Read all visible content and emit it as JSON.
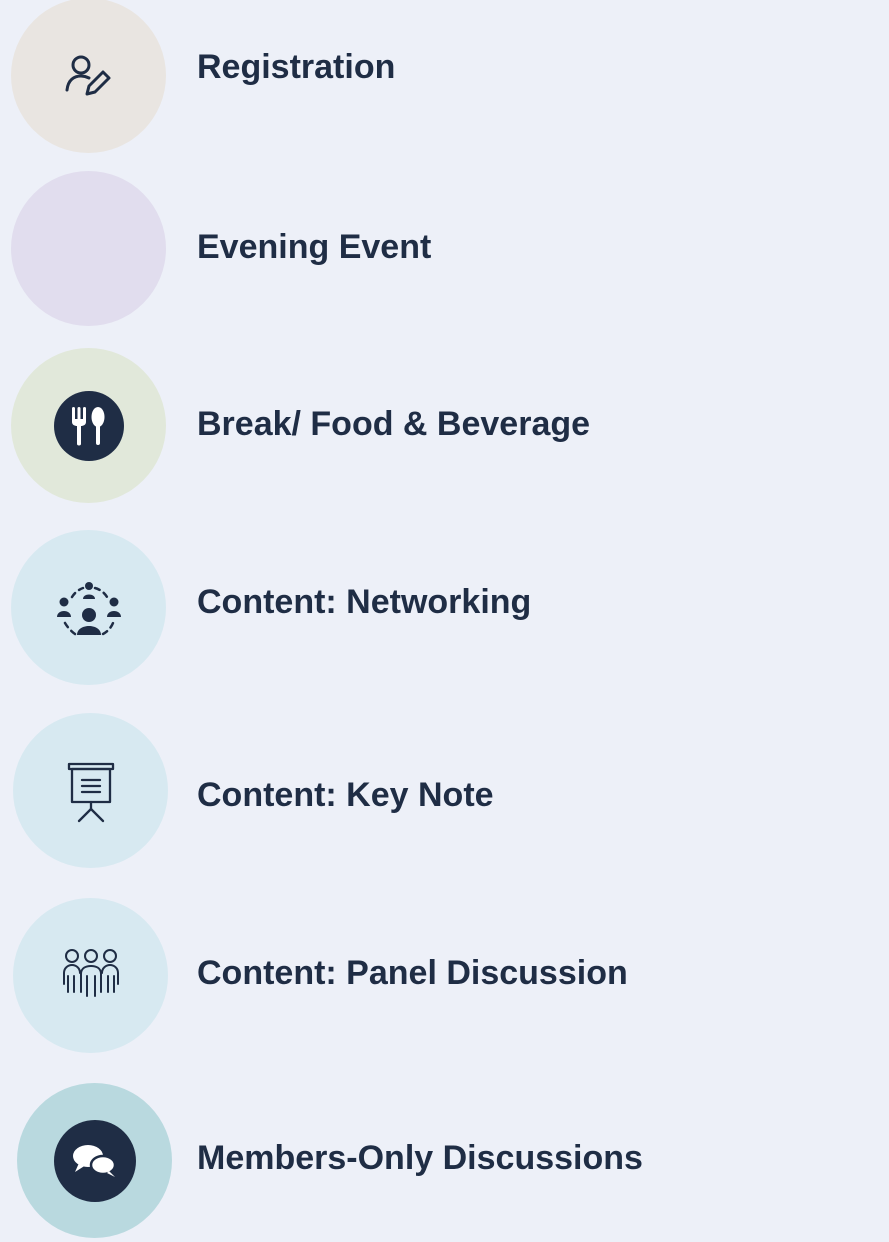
{
  "legend": {
    "items": [
      {
        "key": "registration",
        "label": "Registration",
        "color": "#e9e5e1",
        "icon": "user-edit-icon"
      },
      {
        "key": "evening",
        "label": "Evening Event",
        "color": "#e1ddee",
        "icon": ""
      },
      {
        "key": "break",
        "label": "Break/ Food & Beverage",
        "color": "#e1e8da",
        "icon": "fork-spoon-icon"
      },
      {
        "key": "networking",
        "label": "Content: Networking",
        "color": "#d7e9f1",
        "icon": "networking-icon"
      },
      {
        "key": "keynote",
        "label": "Content: Key Note",
        "color": "#d7e9f1",
        "icon": "presentation-board-icon"
      },
      {
        "key": "panel",
        "label": "Content: Panel Discussion",
        "color": "#d7e9f1",
        "icon": "group-people-icon"
      },
      {
        "key": "members",
        "label": "Members-Only Discussions",
        "color": "#b9d9df",
        "icon": "chat-bubbles-icon"
      }
    ]
  },
  "colors": {
    "text": "#1f2d45",
    "icon_dark": "#1f2d45",
    "background": "#edf0f8"
  }
}
